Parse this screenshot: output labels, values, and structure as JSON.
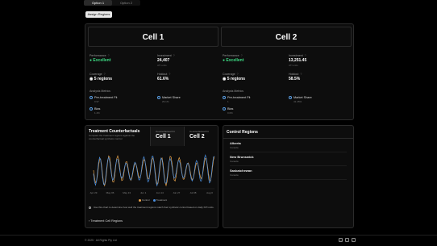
{
  "tabs": [
    {
      "label": "Option 1"
    },
    {
      "label": "Option 2"
    }
  ],
  "assign_button": "Assign Regions",
  "cells": [
    {
      "name": "Cell 1",
      "performance": {
        "label": "Performance",
        "value": "Excellent"
      },
      "investment": {
        "label": "Investment",
        "value": "24,407",
        "sub": "ATI units"
      },
      "coverage": {
        "label": "Coverage",
        "value": "5 regions"
      },
      "holdout": {
        "label": "Holdout",
        "value": "61.6%"
      },
      "analysis_title": "Analysis Metrics",
      "metrics": [
        {
          "name": "Pre-treatment Fit",
          "value": "0.97"
        },
        {
          "name": "Market Share",
          "value": "29.1%"
        },
        {
          "name": "Bias",
          "value": "1.4%"
        }
      ]
    },
    {
      "name": "Cell 2",
      "performance": {
        "label": "Performance",
        "value": "Excellent"
      },
      "investment": {
        "label": "Investment",
        "value": "13,251.45",
        "sub": "ATI units"
      },
      "coverage": {
        "label": "Coverage",
        "value": "5 regions"
      },
      "holdout": {
        "label": "Holdout",
        "value": "58.5%"
      },
      "analysis_title": "Analysis Metrics",
      "metrics": [
        {
          "name": "Pre-treatment Fit",
          "value": "1"
        },
        {
          "name": "Market Share",
          "value": "41.45%"
        },
        {
          "name": "Bias",
          "value": "0.0%"
        }
      ]
    }
  ],
  "chart_panel": {
    "title": "Treatment Counterfactuals",
    "description": "Compare the treatment regions against the counterfactual synthetic control",
    "cell_tabs": [
      {
        "small": "Counterfactual Fit",
        "big": "Cell 1"
      },
      {
        "small": "Counterfactual Fit",
        "big": "Cell 2"
      }
    ],
    "legend": [
      "Control",
      "Treatment"
    ],
    "note": "Use this chart to determine how well the treatment regions match their synthetic control based on daily KPI units.",
    "footer_link": "Treatment Cell Regions"
  },
  "chart_data": {
    "type": "line",
    "x_ticks": [
      "Apr 29",
      "May 06",
      "May 13",
      "Jun 1",
      "Jun 14",
      "Jun 27",
      "Jul 08",
      "Aug 0"
    ],
    "series": [
      {
        "name": "Control",
        "color": "#e8a34a"
      },
      {
        "name": "Treatment",
        "color": "#4a8fe0"
      }
    ]
  },
  "control_panel": {
    "title": "Control Regions",
    "regions": [
      {
        "name": "Alberta",
        "country": "Canada"
      },
      {
        "name": "New Brunswick",
        "country": "Canada"
      },
      {
        "name": "Saskatchewan",
        "country": "Canada"
      }
    ]
  },
  "footer": {
    "copyright": "© 2025 · All Rights Pty Ltd"
  }
}
